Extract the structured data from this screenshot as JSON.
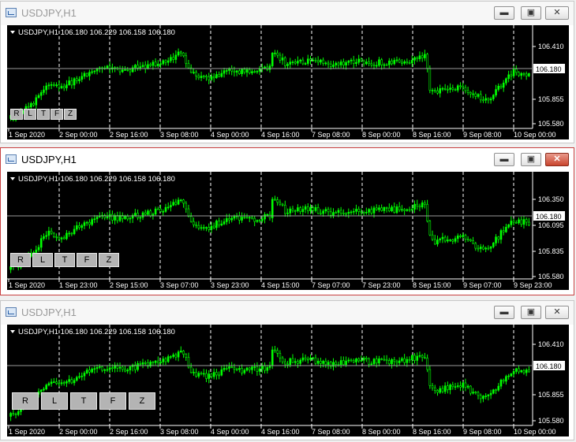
{
  "windows": [
    {
      "title": "USDJPY,H1",
      "active": false,
      "header": "USDJPY,H1  106.180 106.229 106.158 106.180",
      "price_labels": [
        "106.410",
        "105.855",
        "105.580"
      ],
      "current_price": "106.180",
      "time_labels": [
        "1 Sep 2020",
        "2 Sep 00:00",
        "2 Sep 16:00",
        "3 Sep 08:00",
        "4 Sep 00:00",
        "4 Sep 16:00",
        "7 Sep 08:00",
        "8 Sep 00:00",
        "8 Sep 16:00",
        "9 Sep 08:00",
        "10 Sep 00:00"
      ],
      "buttons": [
        "R",
        "L",
        "T",
        "F",
        "Z"
      ]
    },
    {
      "title": "USDJPY,H1",
      "active": true,
      "header": "USDJPY,H1  106.180 106.229 106.158 106.180",
      "price_labels": [
        "106.350",
        "106.095",
        "105.835",
        "105.580"
      ],
      "current_price": "106.180",
      "time_labels": [
        "1 Sep 2020",
        "1 Sep 23:00",
        "2 Sep 15:00",
        "3 Sep 07:00",
        "3 Sep 23:00",
        "4 Sep 15:00",
        "7 Sep 07:00",
        "7 Sep 23:00",
        "8 Sep 15:00",
        "9 Sep 07:00",
        "9 Sep 23:00"
      ],
      "buttons": [
        "R",
        "L",
        "T",
        "F",
        "Z"
      ]
    },
    {
      "title": "USDJPY,H1",
      "active": false,
      "header": "USDJPY,H1  106.180 106.229 106.158 106.180",
      "price_labels": [
        "106.410",
        "105.855",
        "105.580"
      ],
      "current_price": "106.180",
      "time_labels": [
        "1 Sep 2020",
        "2 Sep 00:00",
        "2 Sep 16:00",
        "3 Sep 08:00",
        "4 Sep 00:00",
        "4 Sep 16:00",
        "7 Sep 08:00",
        "8 Sep 00:00",
        "8 Sep 16:00",
        "9 Sep 08:00",
        "10 Sep 00:00"
      ],
      "buttons": [
        "R",
        "L",
        "T",
        "F",
        "Z"
      ]
    }
  ],
  "window_controls": {
    "minimize": "minimize-icon",
    "maximize": "maximize-icon",
    "close": "close-icon"
  },
  "colors": {
    "bars": "#00ff00",
    "chart_bg": "#000000",
    "grid": "#ffffff",
    "text": "#ffffff"
  }
}
